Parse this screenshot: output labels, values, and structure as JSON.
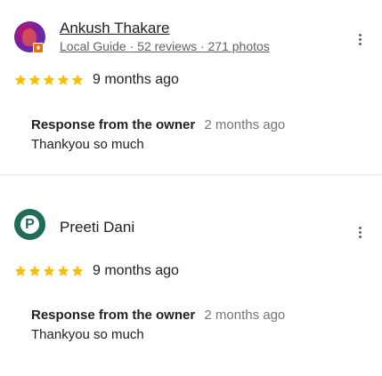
{
  "colors": {
    "star": "#fbbc04",
    "text_primary": "#202124",
    "text_secondary": "#5f6368",
    "avatar_p_bg": "#1f6b5c",
    "guide_badge": "#e8710a"
  },
  "reviews": [
    {
      "reviewer_name": "Ankush Thakare",
      "reviewer_meta": "Local Guide · 52 reviews · 271 photos",
      "avatar_type": "photo",
      "rating": 5,
      "time": "9 months ago",
      "more_icon": "more-vert-icon",
      "owner_response": {
        "label": "Response from the owner",
        "time": "2 months ago",
        "text": "Thankyou so much"
      }
    },
    {
      "reviewer_name": "Preeti Dani",
      "avatar_letter": "P",
      "avatar_type": "letter",
      "rating": 5,
      "time": "9 months ago",
      "more_icon": "more-vert-icon",
      "owner_response": {
        "label": "Response from the owner",
        "time": "2 months ago",
        "text": "Thankyou so much"
      }
    }
  ]
}
